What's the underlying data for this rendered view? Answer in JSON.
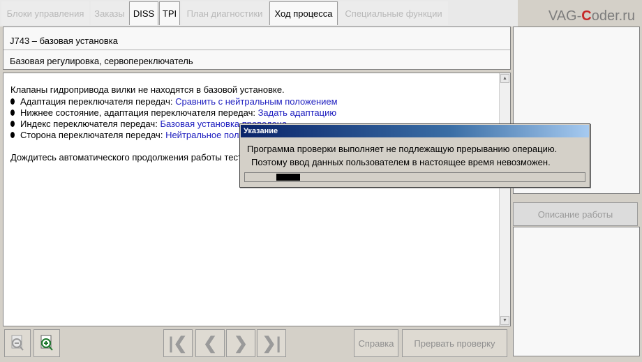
{
  "tabs": [
    {
      "label": "Блоки управления",
      "active": false
    },
    {
      "label": "Заказы",
      "active": false
    },
    {
      "label": "DISS",
      "active": true
    },
    {
      "label": "TPI",
      "active": true
    },
    {
      "label": "План диагностики",
      "active": false
    },
    {
      "label": "Ход процесса",
      "active": true
    },
    {
      "label": "Специальные функции",
      "active": false
    }
  ],
  "logo": {
    "prefix": "VAG-",
    "accent": "C",
    "suffix": "oder.ru"
  },
  "header": {
    "title": "J743 – базовая установка",
    "subtitle": "Базовая регулировка, сервопереключатель"
  },
  "content": {
    "intro": "Клапаны гидропривода вилки не находятся в базовой установке.",
    "items": [
      {
        "label": "Адаптация переключателя передач: ",
        "value": "Сравнить с нейтральным положением"
      },
      {
        "label": "Нижнее состояние, адаптация переключателя передач: ",
        "value": "Задать адаптацию"
      },
      {
        "label": "Индекс переключателя передач: ",
        "value": "Базовая установка проведена"
      },
      {
        "label": "Сторона переключателя передач: ",
        "value": "Нейтральное положение"
      }
    ],
    "footer": "Дождитесь автоматического продолжения работы теста."
  },
  "right": {
    "description_button": "Описание работы"
  },
  "toolbar": {
    "help_button": "Справка",
    "abort_button": "Прервать проверку"
  },
  "dialog": {
    "title": "Указание",
    "message_line1": "Программа проверки выполняет не подлежащую прерыванию операцию.",
    "message_line2": "Поэтому ввод данных пользователем в настоящее время невозможен."
  },
  "colors": {
    "link_blue": "#2020c0",
    "titlebar_start": "#0a246a",
    "logo_accent": "#c62828"
  }
}
